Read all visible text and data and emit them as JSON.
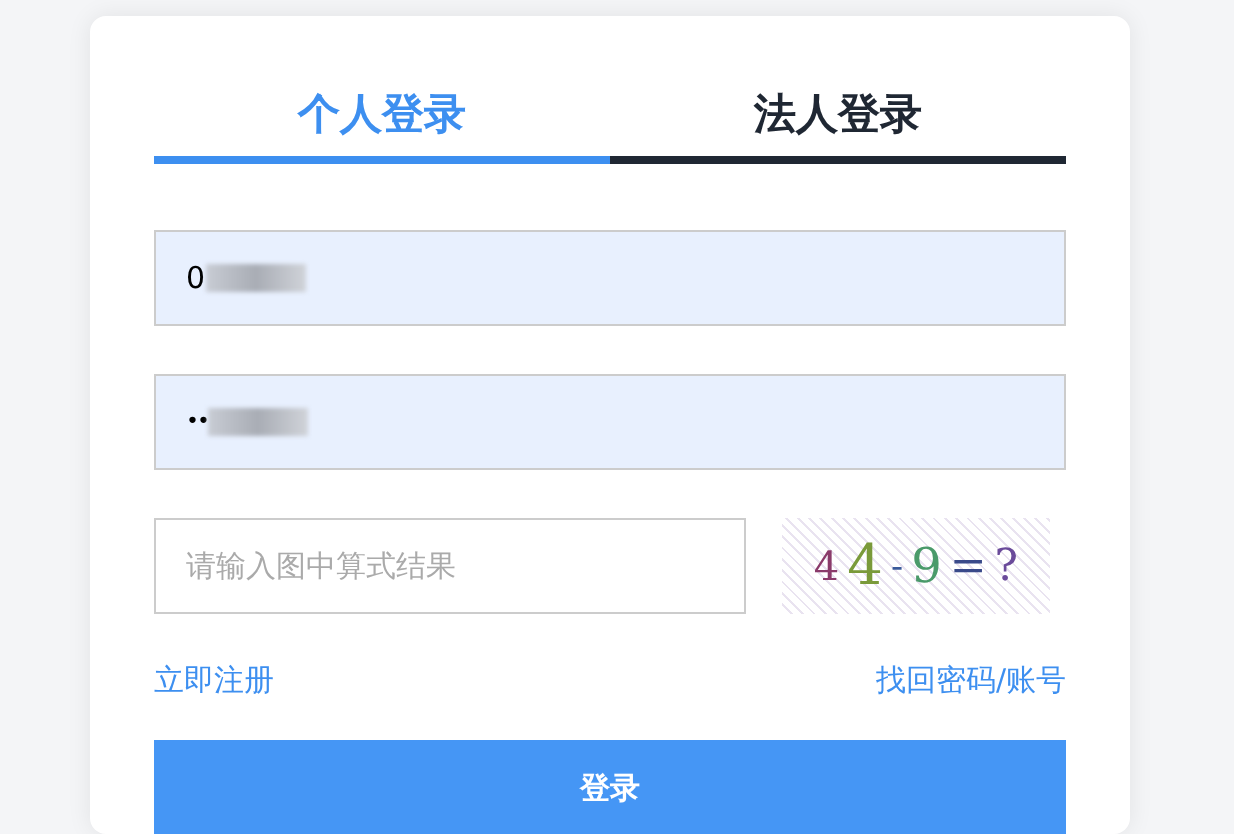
{
  "tabs": [
    {
      "label": "个人登录",
      "selected": true
    },
    {
      "label": "法人登录",
      "selected": false
    }
  ],
  "fields": [
    {
      "kind": "text",
      "value": "0",
      "redacted": true
    },
    {
      "kind": "password",
      "value": "••",
      "redacted": true
    }
  ],
  "captcha": {
    "placeholder": "请输入图中算式结果",
    "image_text": [
      "4",
      "4",
      "-",
      "9",
      "=",
      "?"
    ]
  },
  "links": [
    "立即注册",
    "找回密码/账号"
  ],
  "submit": "登录"
}
